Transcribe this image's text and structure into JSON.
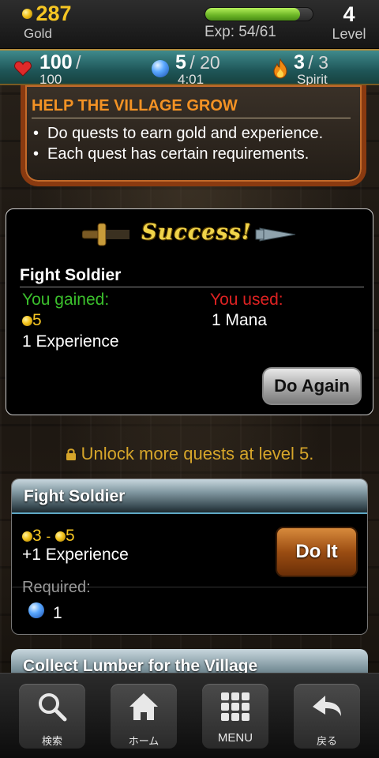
{
  "header": {
    "gold_value": "287",
    "gold_label": "Gold",
    "exp_text": "Exp: 54/61",
    "exp_progress": 0.885,
    "level_value": "4",
    "level_label": "Level"
  },
  "stats": {
    "health_current": "100",
    "health_separator": "/",
    "health_max": "100",
    "mana_current": "5",
    "mana_max": "/ 20",
    "mana_timer": "4:01",
    "spirit_current": "3",
    "spirit_max": "/ 3",
    "spirit_label": "Spirit"
  },
  "help": {
    "title": "HELP THE VILLAGE GROW",
    "items": [
      "Do quests to earn gold and experience.",
      "Each quest has certain requirements."
    ]
  },
  "result": {
    "banner_text": "Success!",
    "quest_name": "Fight Soldier",
    "gained_label": "You gained:",
    "used_label": "You used:",
    "gained_gold": "5",
    "gained_exp": "1 Experience",
    "used_mana": "1 Mana",
    "do_again_label": "Do Again"
  },
  "unlock_text": "Unlock more quests at level 5.",
  "quest_card": {
    "title": "Fight Soldier",
    "gold_min": "3",
    "gold_range_sep": "-",
    "gold_max": "5",
    "exp_reward": "+1 Experience",
    "do_it_label": "Do It",
    "required_label": "Required:",
    "required_mana": "1"
  },
  "quest_card_2": {
    "title": "Collect Lumber for the Village"
  },
  "nav": {
    "search_label": "検索",
    "home_label": "ホーム",
    "menu_label": "MENU",
    "back_label": "戻る"
  },
  "colors": {
    "gold": "#f6c623",
    "gained": "#3bbf2c",
    "used": "#dd2222",
    "help_title": "#f39224",
    "unlock": "#d6a52a"
  }
}
